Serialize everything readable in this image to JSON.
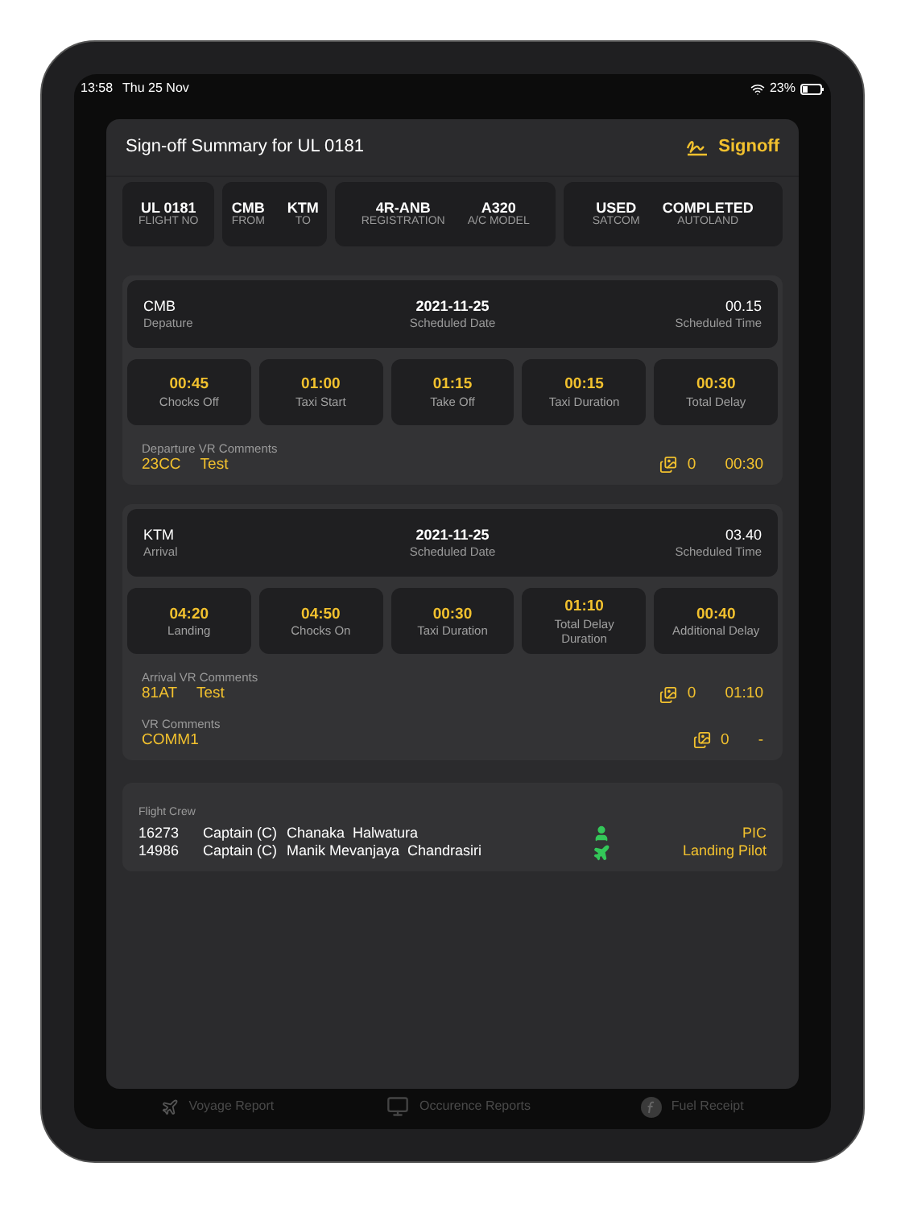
{
  "status_bar": {
    "time": "13:58",
    "date": "Thu 25 Nov",
    "battery": "23%"
  },
  "modal": {
    "title": "Sign-off Summary for UL 0181",
    "action": "Signoff"
  },
  "summary": [
    {
      "items": [
        {
          "value": "UL 0181",
          "label": "FLIGHT NO"
        }
      ]
    },
    {
      "items": [
        {
          "value": "CMB",
          "label": "FROM"
        },
        {
          "value": "KTM",
          "label": "TO"
        }
      ]
    },
    {
      "items": [
        {
          "value": "4R-ANB",
          "label": "REGISTRATION"
        },
        {
          "value": "A320",
          "label": "A/C MODEL"
        }
      ]
    },
    {
      "items": [
        {
          "value": "USED",
          "label": "SATCOM"
        },
        {
          "value": "COMPLETED",
          "label": "AUTOLAND"
        }
      ]
    }
  ],
  "legs": [
    {
      "station": "CMB",
      "station_label": "Depature",
      "date": "2021-11-25",
      "date_label": "Scheduled Date",
      "time": "00.15",
      "time_label": "Scheduled Time",
      "times": [
        {
          "value": "00:45",
          "label": "Chocks Off"
        },
        {
          "value": "01:00",
          "label": "Taxi Start"
        },
        {
          "value": "01:15",
          "label": "Take Off"
        },
        {
          "value": "00:15",
          "label": "Taxi Duration"
        },
        {
          "value": "00:30",
          "label": "Total Delay"
        }
      ],
      "comments": [
        {
          "title": "Departure VR Comments",
          "code": "23CC",
          "text": "Test",
          "count": "0",
          "value": "00:30"
        }
      ]
    },
    {
      "station": "KTM",
      "station_label": "Arrival",
      "date": "2021-11-25",
      "date_label": "Scheduled Date",
      "time": "03.40",
      "time_label": "Scheduled Time",
      "times": [
        {
          "value": "04:20",
          "label": "Landing"
        },
        {
          "value": "04:50",
          "label": "Chocks On"
        },
        {
          "value": "00:30",
          "label": "Taxi Duration"
        },
        {
          "value": "01:10",
          "label": "Total Delay Duration"
        },
        {
          "value": "00:40",
          "label": "Additional Delay"
        }
      ],
      "comments": [
        {
          "title": "Arrival VR Comments",
          "code": "81AT",
          "text": "Test",
          "count": "0",
          "value": "01:10"
        },
        {
          "title": "VR Comments",
          "code": "COMM1",
          "count": "0",
          "value": "-"
        }
      ]
    }
  ],
  "crew": {
    "title": "Flight Crew",
    "members": [
      {
        "id": "16273",
        "rank": "Captain (C)",
        "name": "Chanaka  Halwatura",
        "role": "PIC",
        "kind": "person"
      },
      {
        "id": "14986",
        "rank": "Captain (C)",
        "name": "Manik Mevanjaya  Chandrasiri",
        "role": "Landing Pilot",
        "kind": "plane"
      }
    ]
  },
  "tabs": [
    {
      "label": "Voyage Report",
      "kind": "plane"
    },
    {
      "label": "Occurence Reports",
      "kind": "monitor"
    },
    {
      "label": "Fuel Receipt",
      "kind": "fuel"
    }
  ]
}
